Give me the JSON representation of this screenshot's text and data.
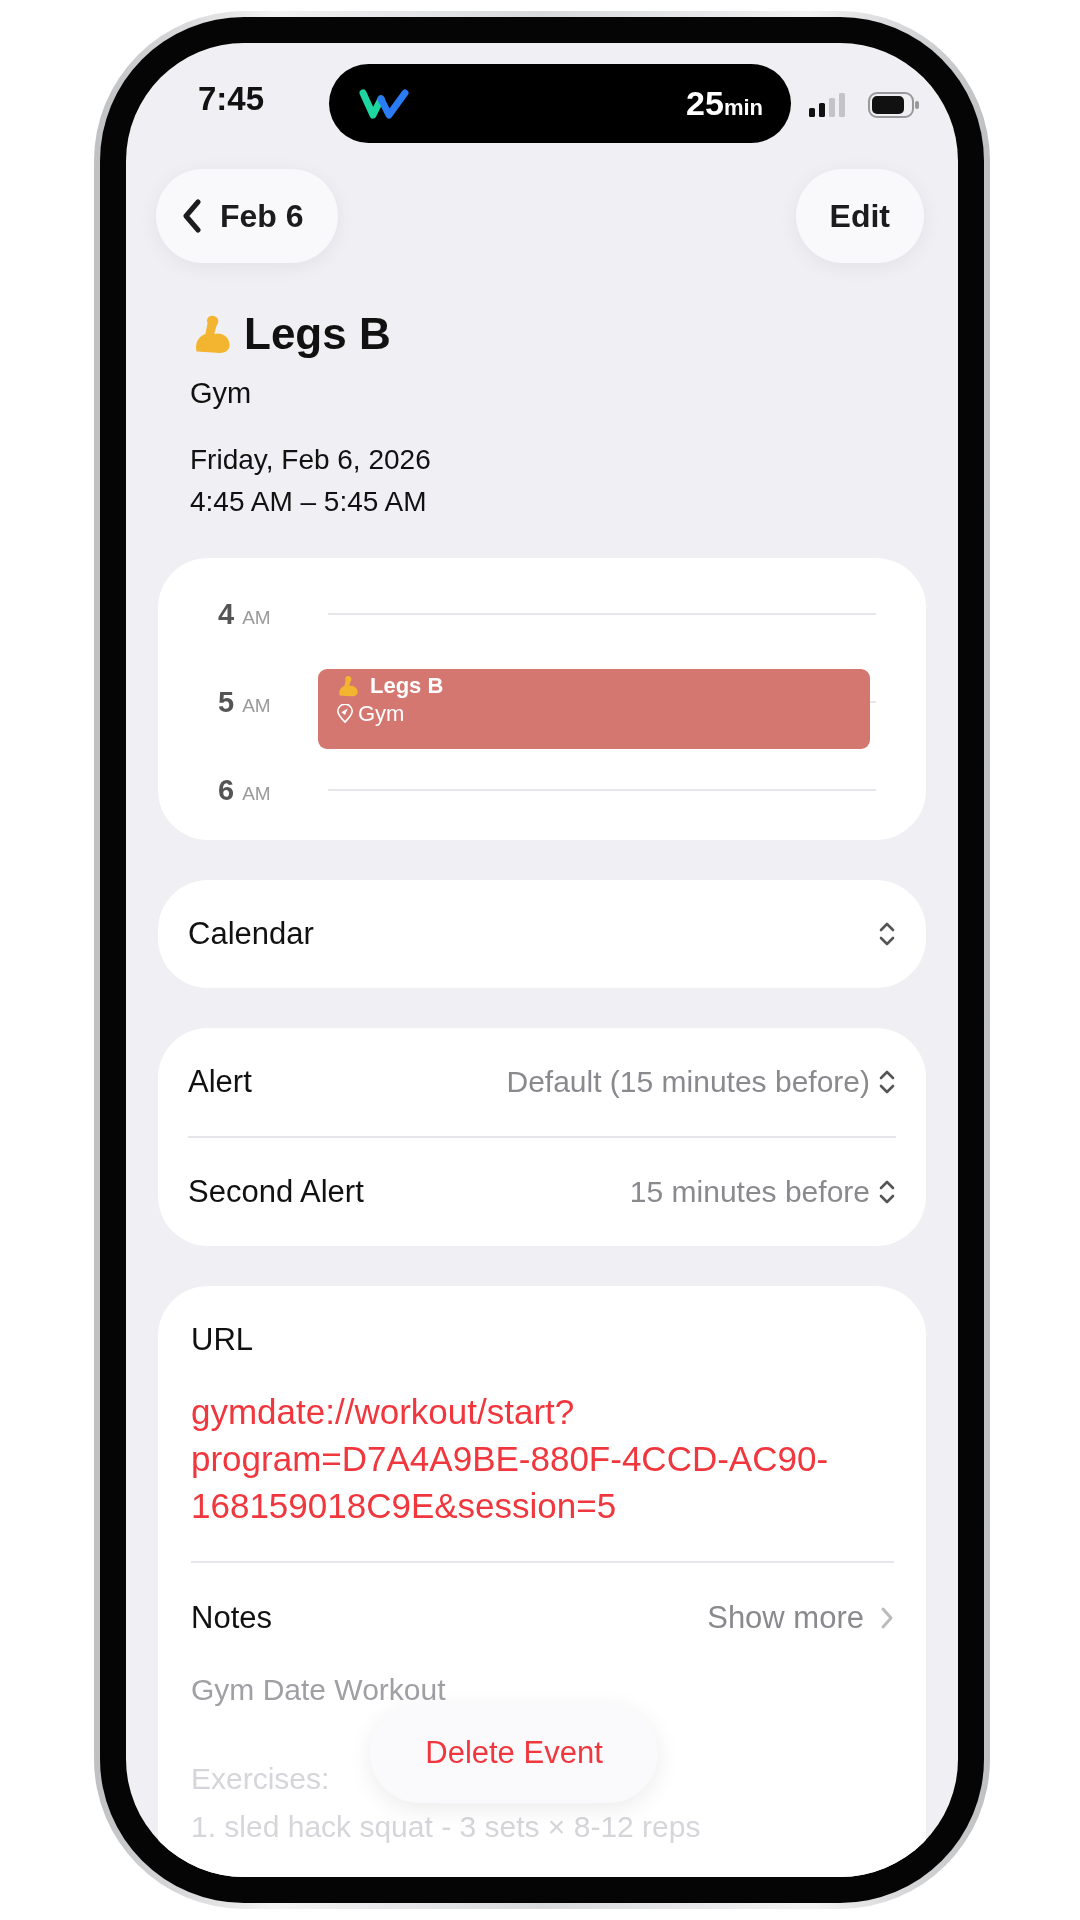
{
  "status_bar": {
    "time": "7:45",
    "live_activity": {
      "timer": "25",
      "unit": "min"
    }
  },
  "nav": {
    "back_label": "Feb 6",
    "edit_label": "Edit"
  },
  "event": {
    "title": "Legs B",
    "calendar_name": "Gym",
    "date": "Friday, Feb 6, 2026",
    "time_range": "4:45 AM – 5:45 AM"
  },
  "timeline": {
    "hours": [
      {
        "hour": "4",
        "period": "AM"
      },
      {
        "hour": "5",
        "period": "AM"
      },
      {
        "hour": "6",
        "period": "AM"
      }
    ],
    "event_block": {
      "title": "Legs B",
      "location": "Gym"
    }
  },
  "calendar_row": {
    "label": "Calendar"
  },
  "alerts": [
    {
      "label": "Alert",
      "value": "Default (15 minutes before)"
    },
    {
      "label": "Second Alert",
      "value": "15 minutes before"
    }
  ],
  "url": {
    "label": "URL",
    "value": "gymdate://workout/start?program=D7A4A9BE-880F-4CCD-AC90-168159018C9E&session=5"
  },
  "notes": {
    "label": "Notes",
    "show_more": "Show more",
    "title": "Gym Date Workout",
    "lines": [
      "Exercises:",
      "1. sled hack squat - 3 sets × 8-12 reps"
    ]
  },
  "delete_button": "Delete Event"
}
